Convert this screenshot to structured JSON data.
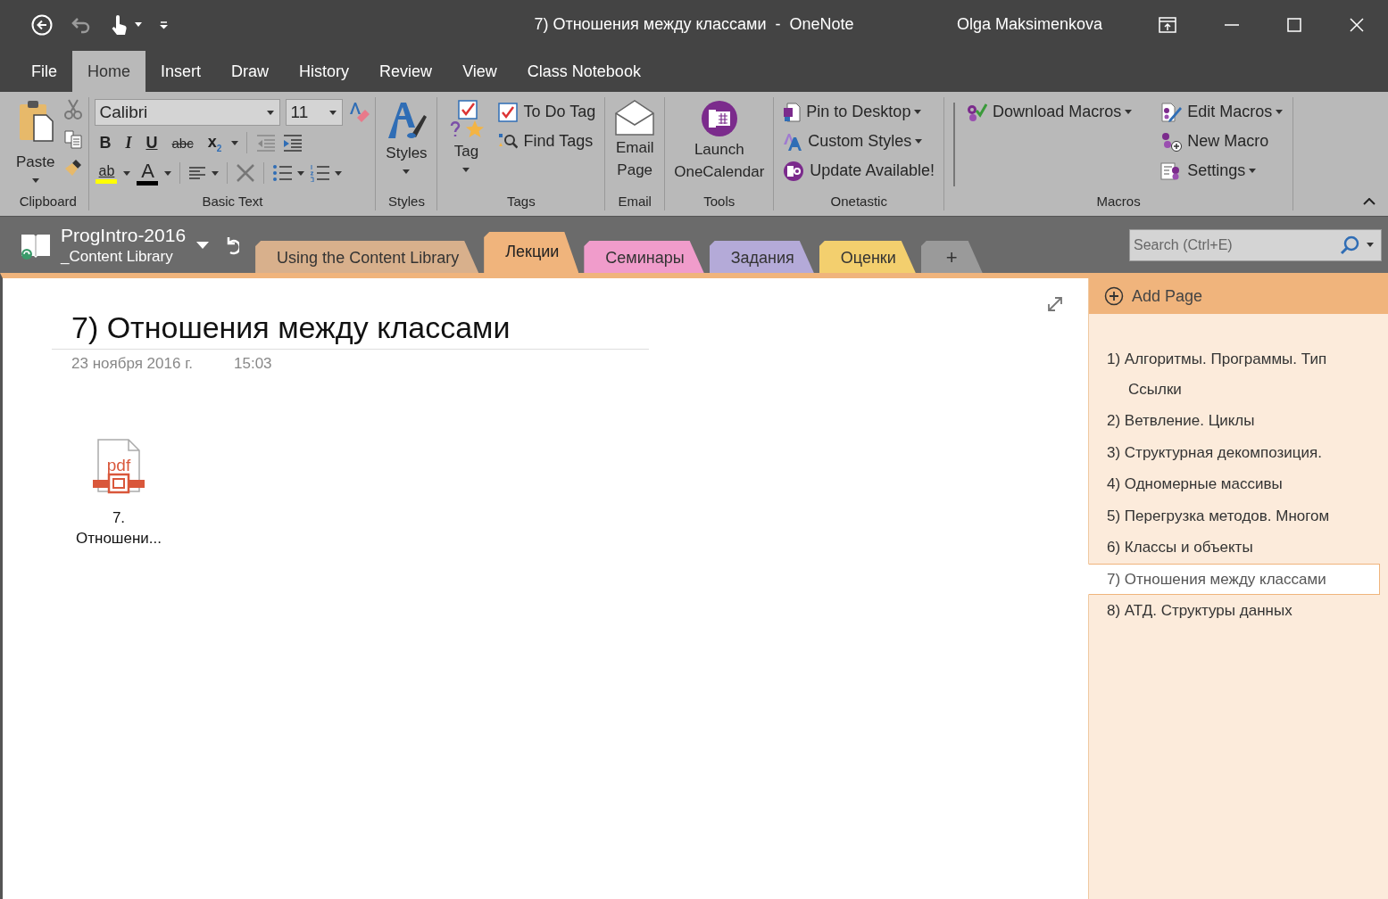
{
  "title_bar": {
    "title": "7) Отношения между классами  -  OneNote",
    "user": "Olga Maksimenkova"
  },
  "menu_tabs": [
    {
      "label": "File",
      "selected": false
    },
    {
      "label": "Home",
      "selected": true
    },
    {
      "label": "Insert",
      "selected": false
    },
    {
      "label": "Draw",
      "selected": false
    },
    {
      "label": "History",
      "selected": false
    },
    {
      "label": "Review",
      "selected": false
    },
    {
      "label": "View",
      "selected": false
    },
    {
      "label": "Class Notebook",
      "selected": false
    }
  ],
  "ribbon": {
    "groups": [
      {
        "label": "Clipboard",
        "kind": "clipboard",
        "paste": {
          "label": "Paste",
          "dropdown": true
        }
      },
      {
        "label": "Basic Text",
        "kind": "basic_text",
        "font": "Calibri",
        "size": "11",
        "format_buttons": [
          "B",
          "I",
          "U",
          "abc",
          "x$_{2}$"
        ],
        "color_buttons": [
          {
            "label": "ab",
            "color": "#ffff00"
          },
          {
            "label": "A",
            "color": "#000000"
          }
        ]
      },
      {
        "label": "Styles",
        "kind": "buttons",
        "columns": [
          [
            {
              "kind": "large",
              "label": "Styles",
              "dropdown": true
            }
          ]
        ]
      },
      {
        "label": "Tags",
        "kind": "buttons",
        "columns": [
          [
            {
              "kind": "large",
              "label": "Tag",
              "dropdown": true
            }
          ],
          [
            {
              "kind": "small",
              "label": "To Do Tag",
              "dropdown": false
            },
            {
              "kind": "small",
              "label": "Find Tags",
              "dropdown": false
            }
          ]
        ]
      },
      {
        "label": "Email",
        "kind": "buttons",
        "columns": [
          [
            {
              "kind": "large",
              "label": "Email Page",
              "dropdown": false
            }
          ]
        ]
      },
      {
        "label": "Tools",
        "kind": "buttons",
        "columns": [
          [
            {
              "kind": "large",
              "label": "Launch OneCalendar",
              "dropdown": false
            }
          ]
        ]
      },
      {
        "label": "Onetastic",
        "kind": "buttons",
        "columns": [
          [
            {
              "kind": "small",
              "label": "Pin to Desktop",
              "dropdown": true
            },
            {
              "kind": "small",
              "label": "Custom Styles",
              "dropdown": true
            },
            {
              "kind": "small",
              "label": "Update Available!",
              "dropdown": false
            }
          ]
        ]
      },
      {
        "label": "Macros",
        "kind": "buttons",
        "columns": [
          [
            {
              "kind": "small",
              "label": "Download Macros",
              "dropdown": true
            }
          ],
          [
            {
              "kind": "small",
              "label": "Edit Macros",
              "dropdown": true
            },
            {
              "kind": "small",
              "label": "New Macro",
              "dropdown": false
            },
            {
              "kind": "small",
              "label": "Settings",
              "dropdown": true
            }
          ]
        ]
      }
    ]
  },
  "notebook": {
    "name": "ProgIntro-2016",
    "subtitle": "_Content Library"
  },
  "section_tabs": [
    {
      "label": "Using the Content Library",
      "color": "#d8b08c",
      "selected": false
    },
    {
      "label": "Лекции",
      "color": "#f0b47c",
      "selected": true
    },
    {
      "label": "Семинары",
      "color": "#f09ccb",
      "selected": false
    },
    {
      "label": "Задания",
      "color": "#b4aad8",
      "selected": false
    },
    {
      "label": "Оценки",
      "color": "#f3cf6e",
      "selected": false
    }
  ],
  "add_section": "+",
  "search": {
    "placeholder": "Search (Ctrl+E)"
  },
  "page": {
    "title": "7) Отношения между классами",
    "date": "23 ноября 2016 г.",
    "time": "15:03",
    "attachments": [
      {
        "file_type": "pdf",
        "lines": [
          "7.",
          "Отношени..."
        ]
      }
    ]
  },
  "page_list": {
    "add_label": "Add Page",
    "pages": [
      {
        "title": "1) Алгоритмы. Программы. Тип",
        "title_continued": "Ссылки",
        "selected": false
      },
      {
        "title": "2) Ветвление. Циклы",
        "selected": false
      },
      {
        "title": "3) Структурная декомпозиция.",
        "selected": false
      },
      {
        "title": "4) Одномерные массивы",
        "selected": false
      },
      {
        "title": "5) Перегрузка методов. Многом",
        "selected": false
      },
      {
        "title": "6) Классы и объекты",
        "selected": false
      },
      {
        "title": "7) Отношения между классами",
        "selected": true
      },
      {
        "title": "8) АТД. Структуры данных",
        "selected": false
      }
    ]
  }
}
